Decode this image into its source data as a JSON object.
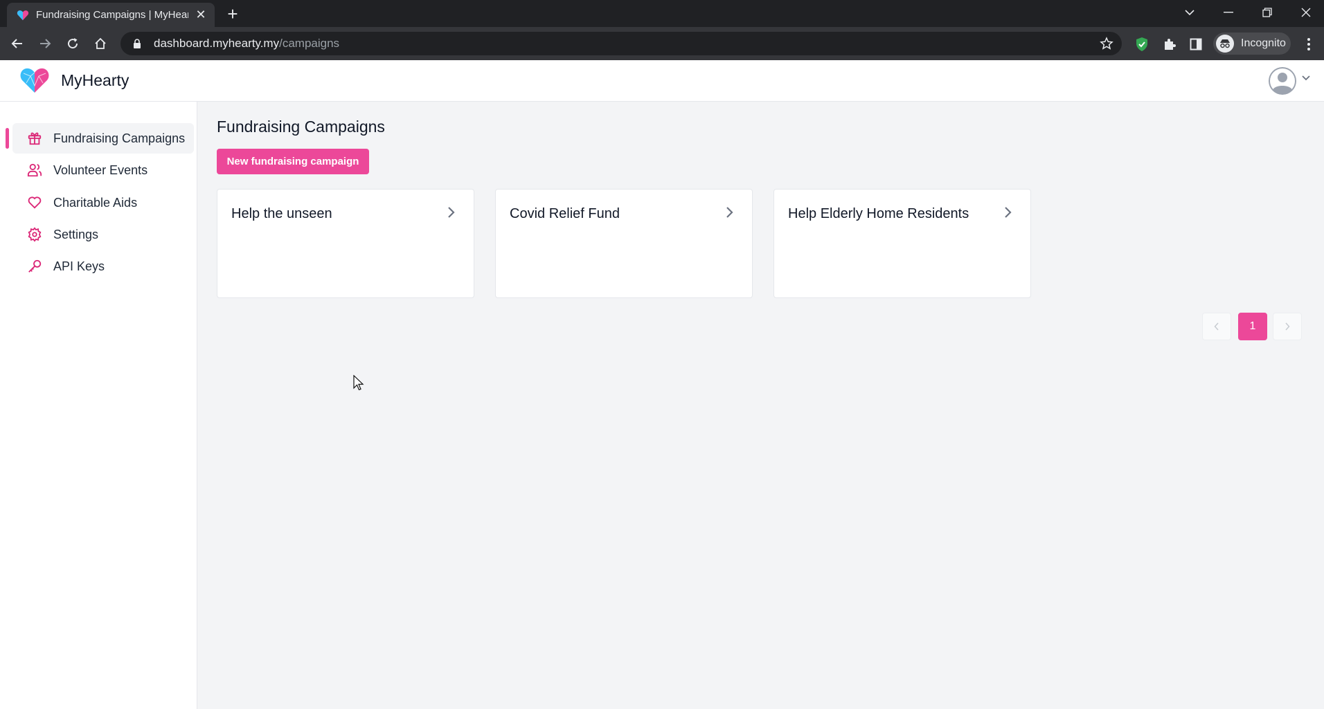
{
  "browser": {
    "tab_title": "Fundraising Campaigns | MyHear",
    "url_host": "dashboard.myhearty.my",
    "url_path": "/campaigns",
    "profile_label": "Incognito"
  },
  "app": {
    "brand_name": "MyHearty",
    "accent_color": "#ec4899"
  },
  "sidebar": {
    "items": [
      {
        "label": "Fundraising Campaigns",
        "icon": "gift-icon",
        "active": true
      },
      {
        "label": "Volunteer Events",
        "icon": "users-icon",
        "active": false
      },
      {
        "label": "Charitable Aids",
        "icon": "heart-icon",
        "active": false
      },
      {
        "label": "Settings",
        "icon": "gear-icon",
        "active": false
      },
      {
        "label": "API Keys",
        "icon": "key-icon",
        "active": false
      }
    ]
  },
  "main": {
    "page_title": "Fundraising Campaigns",
    "new_button_label": "New fundraising campaign",
    "campaigns": [
      {
        "title": "Help the unseen"
      },
      {
        "title": "Covid Relief Fund"
      },
      {
        "title": "Help Elderly Home Residents"
      }
    ],
    "pagination": {
      "current_page": "1"
    }
  }
}
